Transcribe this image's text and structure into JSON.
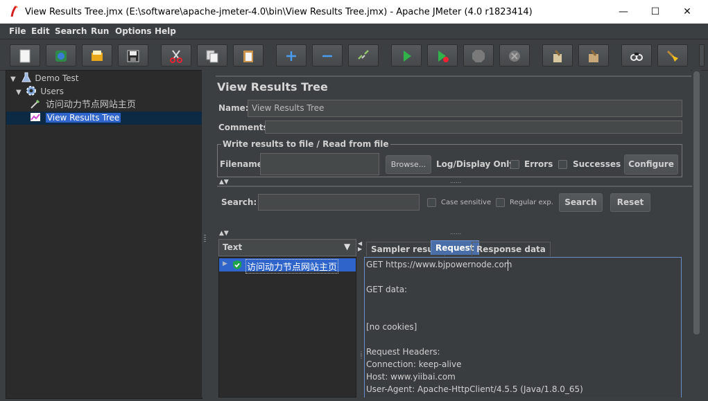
{
  "window": {
    "title": "View Results Tree.jmx (E:\\software\\apache-jmeter-4.0\\bin\\View Results Tree.jmx) - Apache JMeter (4.0 r1823414)",
    "minimize": "—",
    "maximize": "☐",
    "close": "✕"
  },
  "menu": [
    "File",
    "Edit",
    "Search",
    "Run",
    "Options",
    "Help"
  ],
  "toolbar_icons": [
    "new-icon",
    "templates-icon",
    "open-icon",
    "save-icon",
    "cut-icon",
    "copy-icon",
    "paste-icon",
    "expand-icon",
    "collapse-icon",
    "toggle-icon",
    "start-icon",
    "start-no-pauses-icon",
    "stop-icon",
    "shutdown-icon",
    "clear-icon",
    "clear-all-icon",
    "search-icon",
    "reset-search-icon"
  ],
  "tree": {
    "items": [
      {
        "label": "Demo Test",
        "icon": "flask-icon"
      },
      {
        "label": "Users",
        "icon": "gear-icon"
      },
      {
        "label": "访问动力节点网站主页",
        "icon": "pipette-icon"
      },
      {
        "label": "View Results Tree",
        "icon": "chart-icon"
      }
    ]
  },
  "panel": {
    "heading": "View Results Tree",
    "name_label": "Name:",
    "name_value": "View Results Tree",
    "comments_label": "Comments:",
    "comments_value": "",
    "file_group_title": "Write results to file / Read from file",
    "filename_label": "Filename",
    "filename_value": "",
    "browse": "Browse...",
    "log_display_label": "Log/Display Only:",
    "errors_label": "Errors",
    "successes_label": "Successes",
    "configure": "Configure"
  },
  "search": {
    "label": "Search:",
    "value": "",
    "case_sensitive": "Case sensitive",
    "regular_exp": "Regular exp.",
    "search_btn": "Search",
    "reset_btn": "Reset"
  },
  "results": {
    "renderer": "Text",
    "samples": [
      "访问动力节点网站主页"
    ],
    "tabs": [
      "Sampler result",
      "Request",
      "Response data"
    ],
    "active_tab": "Request",
    "request_lines": [
      "GET https://www.bjpowernode.com",
      "",
      "GET data:",
      "",
      "",
      "[no cookies]",
      "",
      "Request Headers:",
      "Connection: keep-alive",
      "Host: www.yiibai.com",
      "User-Agent: Apache-HttpClient/4.5.5 (Java/1.8.0_65)"
    ]
  },
  "colors": {
    "background": "#3c3f41",
    "tree_selection": "#2f65ca",
    "active_tab": "#4a6ea8"
  }
}
